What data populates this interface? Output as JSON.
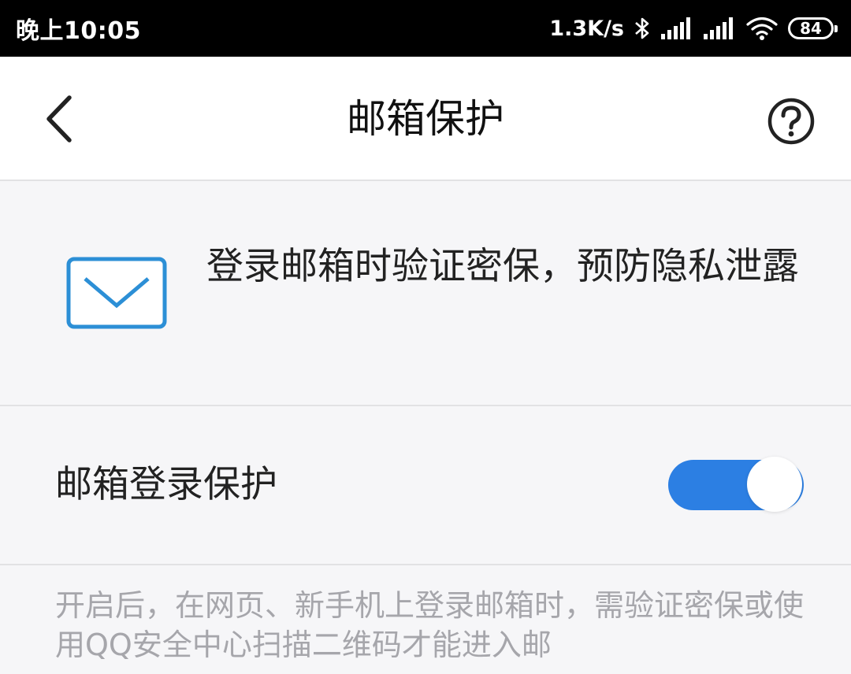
{
  "status_bar": {
    "time": "晚上10:05",
    "network_speed": "1.3K/s",
    "battery": "84",
    "icons": [
      "bluetooth-icon",
      "signal-icon",
      "signal-icon",
      "wifi-icon",
      "battery-icon"
    ]
  },
  "nav": {
    "title": "邮箱保护",
    "back_icon": "chevron-left-icon",
    "help_icon": "question-circle-icon"
  },
  "intro": {
    "icon": "mail-icon",
    "text": "登录邮箱时验证密保，预防隐私泄露"
  },
  "setting": {
    "label": "邮箱登录保护",
    "enabled": true
  },
  "description": "开启后，在网页、新手机上登录邮箱时，需验证密保或使用QQ安全中心扫描二维码才能进入邮",
  "colors": {
    "accent": "#2c7fe3",
    "mail_icon": "#2c8fd6",
    "status_bar_bg": "#000000",
    "page_bg": "#f6f6f8"
  }
}
